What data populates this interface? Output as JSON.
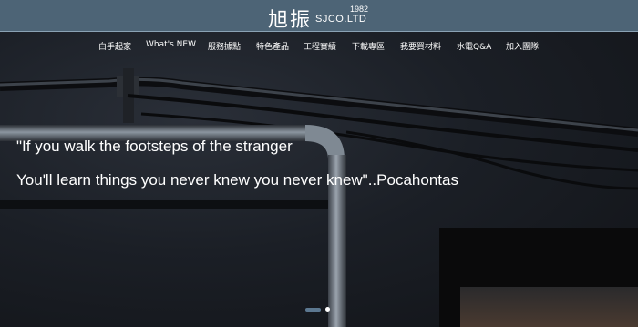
{
  "header": {
    "logo_cn": "旭振",
    "logo_en": "SJCO.LTD",
    "logo_year": "1982"
  },
  "nav": {
    "items": [
      {
        "label": "白手起家"
      },
      {
        "label": "What's NEW"
      },
      {
        "label": "服務據點"
      },
      {
        "label": "特色產品"
      },
      {
        "label": "工程實績"
      },
      {
        "label": "下載專區"
      },
      {
        "label": "我要買材料"
      },
      {
        "label": "水電Q&A"
      },
      {
        "label": "加入團隊"
      }
    ]
  },
  "hero": {
    "quote_line1": "\"If you walk the footsteps of the stranger",
    "quote_line2": "You'll learn things you never knew you never knew\"..Pocahontas"
  },
  "carousel": {
    "slide_count": 2,
    "active_index": 0
  }
}
